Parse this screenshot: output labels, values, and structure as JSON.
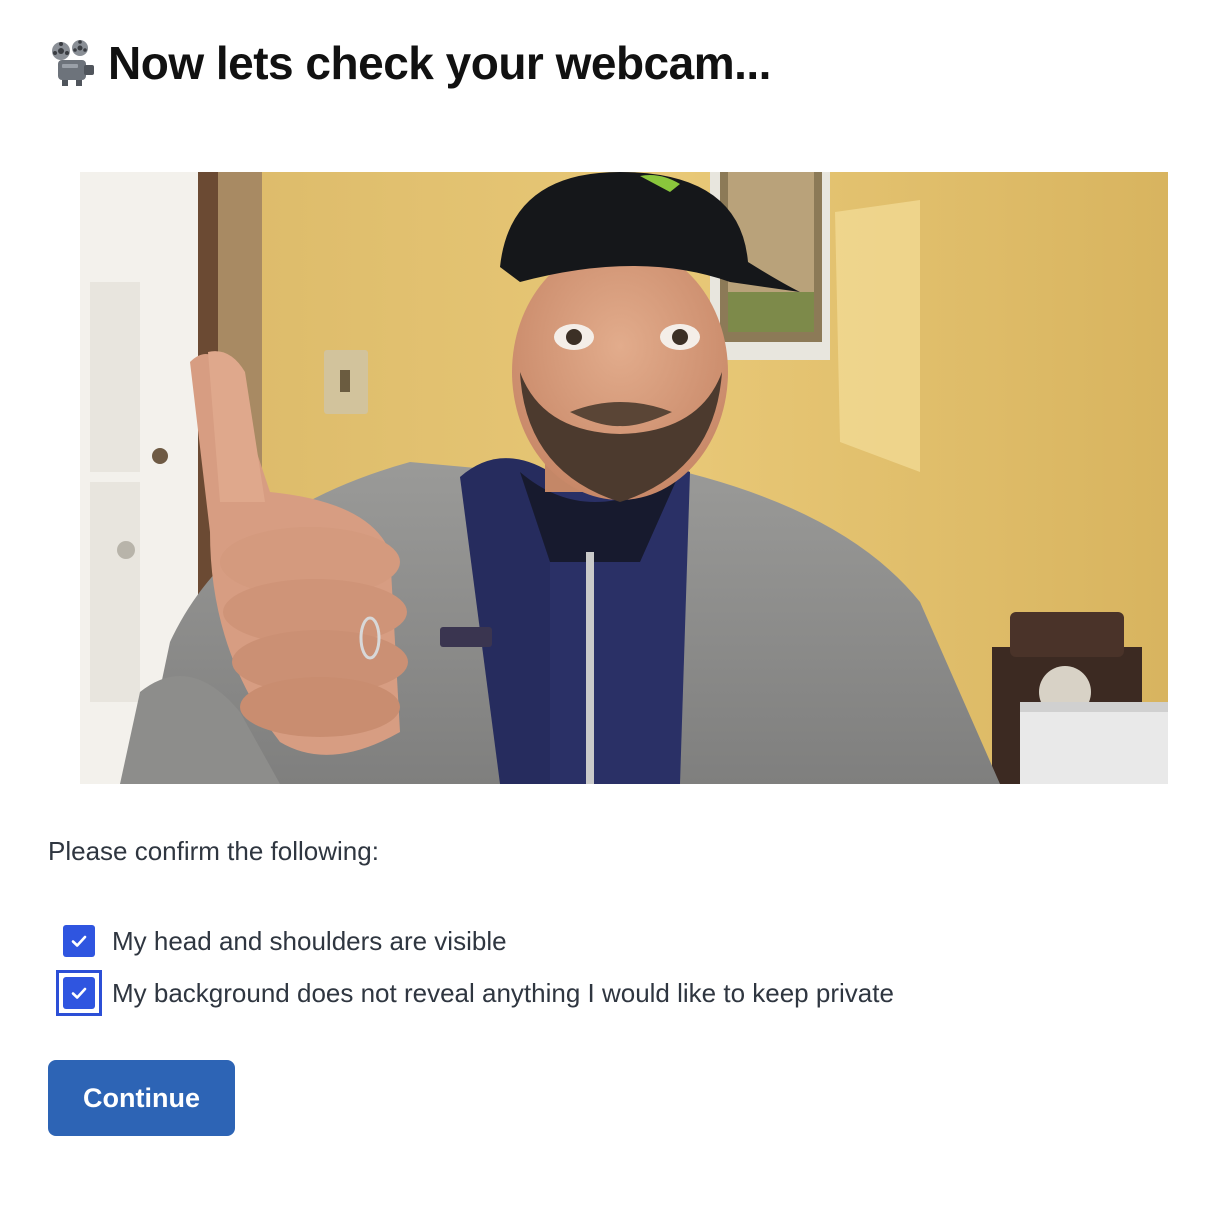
{
  "header": {
    "icon": "film-projector-icon",
    "title": "Now lets check your webcam..."
  },
  "webcam": {
    "preview": "webcam-preview"
  },
  "confirm": {
    "prompt": "Please confirm the following:",
    "items": [
      {
        "label": "My head and shoulders are visible",
        "checked": true
      },
      {
        "label": "My background does not reveal anything I would like to keep private",
        "checked": true,
        "focused": true
      }
    ]
  },
  "actions": {
    "continue_label": "Continue"
  },
  "colors": {
    "accent": "#2f55e0",
    "button": "#2d64b5",
    "text": "#2f3640"
  }
}
